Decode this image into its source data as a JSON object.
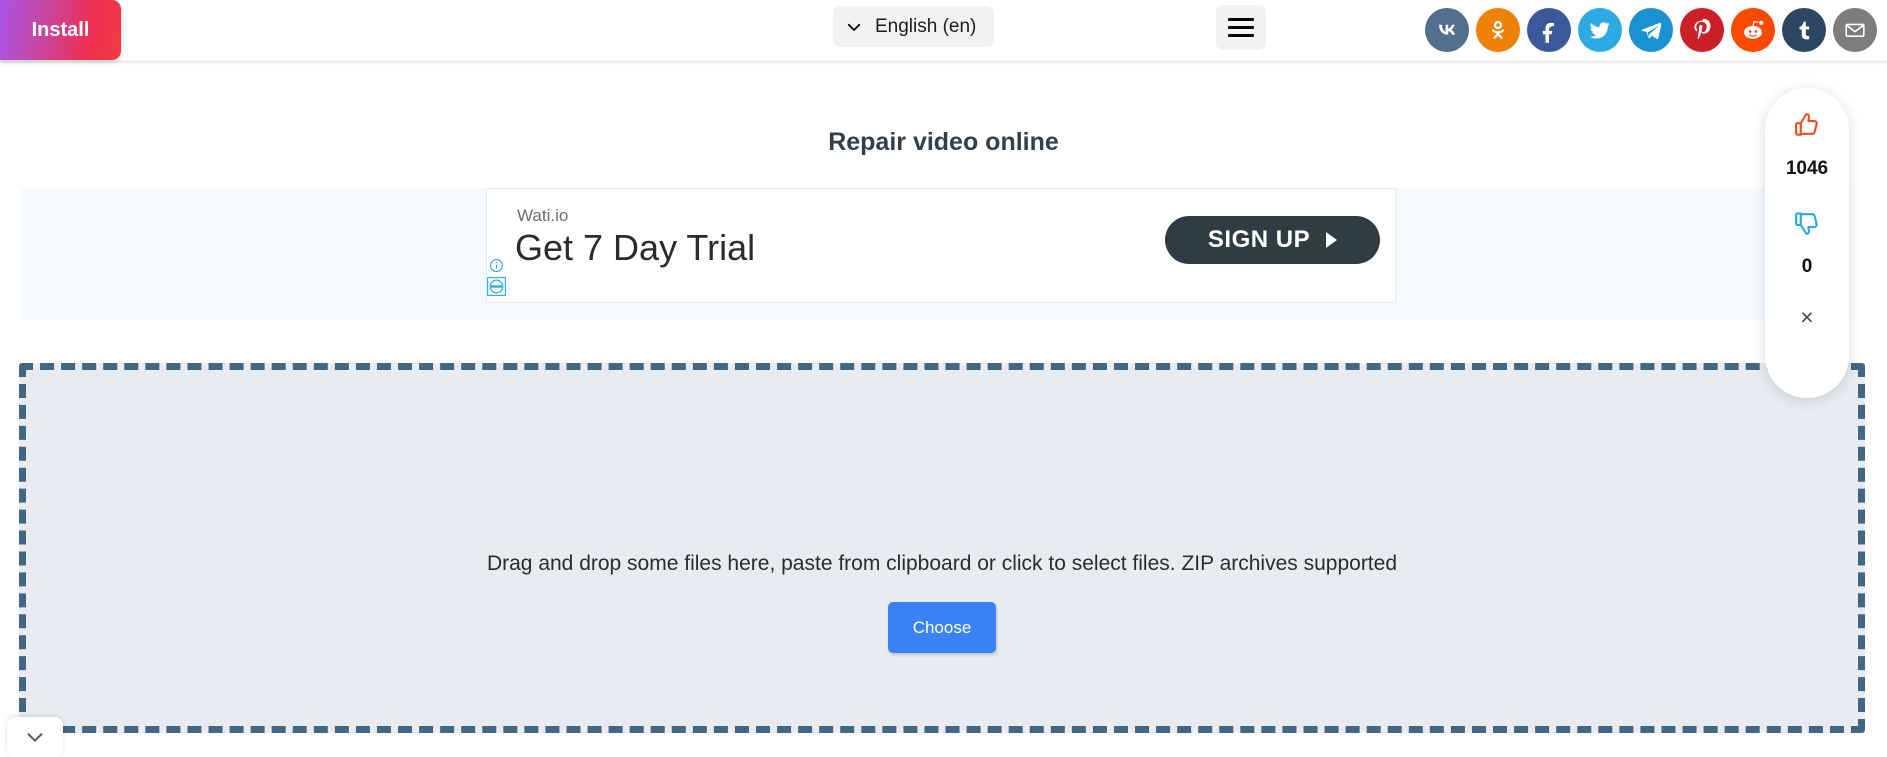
{
  "header": {
    "install_label": "Install",
    "language": {
      "label": "English (en)",
      "icon": "chevron-down-icon"
    },
    "menu_icon": "hamburger-menu-icon",
    "social_icons": [
      {
        "name": "vk-icon",
        "label": "VK",
        "color": "#51708f"
      },
      {
        "name": "odnoklassniki-icon",
        "label": "Odnoklassniki",
        "color": "#ee8208"
      },
      {
        "name": "facebook-icon",
        "label": "Facebook",
        "color": "#3b5998"
      },
      {
        "name": "twitter-icon",
        "label": "Twitter",
        "color": "#2caae1"
      },
      {
        "name": "telegram-icon",
        "label": "Telegram",
        "color": "#1b92d1"
      },
      {
        "name": "pinterest-icon",
        "label": "Pinterest",
        "color": "#cb2027"
      },
      {
        "name": "reddit-icon",
        "label": "Reddit",
        "color": "#fa4a01"
      },
      {
        "name": "tumblr-icon",
        "label": "Tumblr",
        "color": "#2c4762"
      },
      {
        "name": "email-icon",
        "label": "Email",
        "color": "#7d7d7d"
      }
    ]
  },
  "main": {
    "page_title": "Repair video online"
  },
  "ad": {
    "brand": "Wati.io",
    "headline": "Get 7 Day Trial",
    "cta_label": "SIGN UP",
    "adchoices_info_icon": "info-circle-icon",
    "adchoices_badge_icon": "adchoices-icon"
  },
  "dropzone": {
    "instruction": "Drag and drop some files here, paste from clipboard or click to select files. ZIP archives supported",
    "choose_label": "Choose",
    "border_color": "#436683",
    "background": "#e8ecf0"
  },
  "vote_widget": {
    "up_icon": "thumbs-up-icon",
    "up_count": "1046",
    "up_color": "#e8501f",
    "down_icon": "thumbs-down-icon",
    "down_count": "0",
    "down_color": "#2ea8e0",
    "close_icon": "close-icon",
    "close_label": "×"
  },
  "bottom_widget": {
    "icon": "chevron-down-icon"
  },
  "theme": {
    "accent_blue": "#3b82f6",
    "title_color": "#33404a",
    "ad_band_bg": "#f7fafc",
    "signup_bg": "#303c44"
  }
}
